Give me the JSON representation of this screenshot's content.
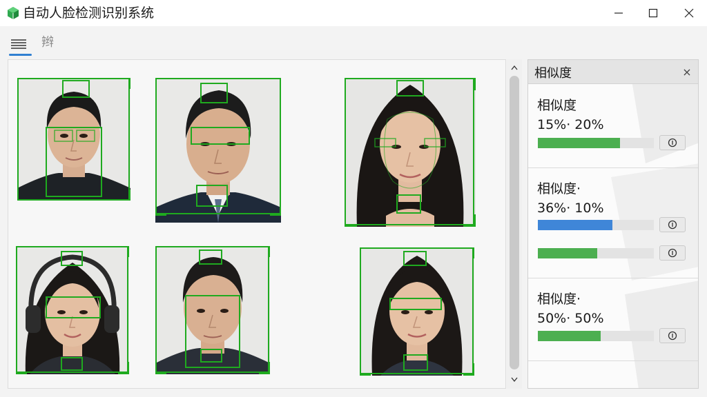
{
  "window": {
    "title": "自动人脸检测识别系统"
  },
  "toolbar": {
    "secondary_label": "辫"
  },
  "panel": {
    "title": "相似度",
    "close_glyph": "×",
    "cards": [
      {
        "label": "相似度",
        "value": "15%· 20%",
        "bars": [
          {
            "fraction": 0.71,
            "color": "#4caf50"
          }
        ]
      },
      {
        "label": "相似度·",
        "value": "36%· 10%",
        "bars": [
          {
            "fraction": 0.64,
            "color": "#3f86d8"
          },
          {
            "fraction": 0.51,
            "color": "#4caf50"
          }
        ]
      },
      {
        "label": "相似度·",
        "value": "50%· 50%",
        "bars": [
          {
            "fraction": 0.54,
            "color": "#4caf50"
          }
        ]
      }
    ]
  },
  "colors": {
    "detection_box": "#1faa1f",
    "accent": "#2f7fd1"
  },
  "icons": [
    "app-cube-icon",
    "minimize-icon",
    "maximize-icon",
    "close-icon",
    "menu-icon",
    "scroll-up-icon",
    "scroll-down-icon",
    "info-icon"
  ]
}
